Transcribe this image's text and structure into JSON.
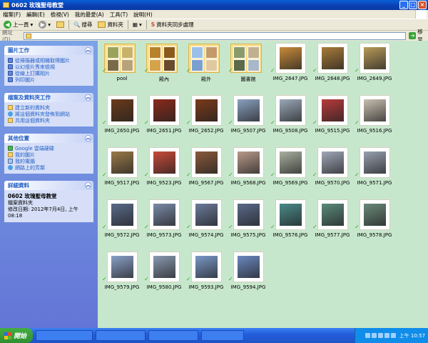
{
  "window": {
    "title": "0602 玫瑰聖母教堂"
  },
  "menu": [
    "檔案(F)",
    "編輯(E)",
    "檢視(V)",
    "我的最愛(A)",
    "工具(T)",
    "說明(H)"
  ],
  "toolbar": {
    "back": "上一頁",
    "search": "搜尋",
    "folders": "資料夾",
    "sync": "資料夾同步處理"
  },
  "address": {
    "label": "網址(D)",
    "go": "移至"
  },
  "panels": {
    "picture_tasks": {
      "title": "圖片工作",
      "items": [
        "從掃描器或相機取得圖片",
        "以幻燈片秀來檢視",
        "從線上訂購相片",
        "列印圖片"
      ]
    },
    "file_tasks": {
      "title": "檔案及資料夾工作",
      "items": [
        "建立新的資料夾",
        "將這個資料夾發佈到網站",
        "共用這個資料夾"
      ]
    },
    "other_places": {
      "title": "其他位置",
      "items": [
        "Google 雲端硬碟",
        "我的圖片",
        "我的電腦",
        "網路上的芳鄰"
      ]
    },
    "details": {
      "title": "詳細資料",
      "name": "0602 玫瑰聖母教堂",
      "type": "檔案資料夾",
      "modified": "修改日期: 2012年7月4日, 上午 08:18"
    }
  },
  "items": [
    {
      "label": "pool",
      "kind": "folder",
      "colors": [
        "#9aa35a",
        "#c8b26a",
        "#7a6a4a",
        "#b9a27a"
      ]
    },
    {
      "label": "殿內",
      "kind": "folder",
      "colors": [
        "#b8822a",
        "#8a5a1a",
        "#d6a24a",
        "#6a4a2a"
      ]
    },
    {
      "label": "殿外",
      "kind": "folder",
      "colors": [
        "#9ac0e8",
        "#c49a6a",
        "#7aa0d0",
        "#e0c8a0"
      ]
    },
    {
      "label": "圖書館",
      "kind": "folder",
      "colors": [
        "#8a9a6a",
        "#c0b090",
        "#5a6a4a",
        "#a8b8c8"
      ]
    },
    {
      "label": "IMG_2647.JPG",
      "kind": "photo",
      "color": "#c88a3a"
    },
    {
      "label": "IMG_2648.JPG",
      "kind": "photo",
      "color": "#a87a3a"
    },
    {
      "label": "IMG_2649.JPG",
      "kind": "photo",
      "color": "#b89a5a"
    },
    {
      "label": "IMG_2650.JPG",
      "kind": "photo",
      "color": "#6a3a1a"
    },
    {
      "label": "IMG_2651.JPG",
      "kind": "photo",
      "color": "#8a2a1a"
    },
    {
      "label": "IMG_2652.JPG",
      "kind": "photo",
      "color": "#7a3a1a"
    },
    {
      "label": "IMG_9507.JPG",
      "kind": "photo",
      "color": "#8aa0c0"
    },
    {
      "label": "IMG_9508.JPG",
      "kind": "photo",
      "color": "#9aa8b8"
    },
    {
      "label": "IMG_9515.JPG",
      "kind": "photo",
      "color": "#b83a3a"
    },
    {
      "label": "IMG_9516.JPG",
      "kind": "photo",
      "color": "#c8c0b0"
    },
    {
      "label": "IMG_9517.JPG",
      "kind": "photo",
      "color": "#9a7a4a"
    },
    {
      "label": "IMG_9523.JPG",
      "kind": "photo",
      "color": "#c84a3a"
    },
    {
      "label": "IMG_9567.JPG",
      "kind": "photo",
      "color": "#8a5a3a"
    },
    {
      "label": "IMG_9568.JPG",
      "kind": "photo",
      "color": "#b89a8a"
    },
    {
      "label": "IMG_9569.JPG",
      "kind": "photo",
      "color": "#a8b0a0"
    },
    {
      "label": "IMG_9570.JPG",
      "kind": "photo",
      "color": "#a0a8b8"
    },
    {
      "label": "IMG_9571.JPG",
      "kind": "photo",
      "color": "#98a0b0"
    },
    {
      "label": "IMG_9572.JPG",
      "kind": "photo",
      "color": "#5a6a8a"
    },
    {
      "label": "IMG_9573.JPG",
      "kind": "photo",
      "color": "#7a8aa8"
    },
    {
      "label": "IMG_9574.JPG",
      "kind": "photo",
      "color": "#6a7a9a"
    },
    {
      "label": "IMG_9575.JPG",
      "kind": "photo",
      "color": "#5a6a8a"
    },
    {
      "label": "IMG_9576.JPG",
      "kind": "photo",
      "color": "#4a8a8a"
    },
    {
      "label": "IMG_9577.JPG",
      "kind": "photo",
      "color": "#5a8a7a"
    },
    {
      "label": "IMG_9578.JPG",
      "kind": "photo",
      "color": "#6a8a7a"
    },
    {
      "label": "IMG_9579.JPG",
      "kind": "photo",
      "color": "#8aa0c8"
    },
    {
      "label": "IMG_9580.JPG",
      "kind": "photo",
      "color": "#8a9ab0"
    },
    {
      "label": "IMG_9593.JPG",
      "kind": "photo",
      "color": "#7a98c8"
    },
    {
      "label": "IMG_9594.JPG",
      "kind": "photo",
      "color": "#6a88c0"
    }
  ],
  "taskbar": {
    "start": "開始",
    "clock": "上午 10:57"
  },
  "colors": {
    "content_bg": "#c7e7cc",
    "title_blue": "#0b3fb0",
    "panel_blue": "#6375d6",
    "link_blue": "#215dc6",
    "start_green": "#2f8f2f"
  }
}
